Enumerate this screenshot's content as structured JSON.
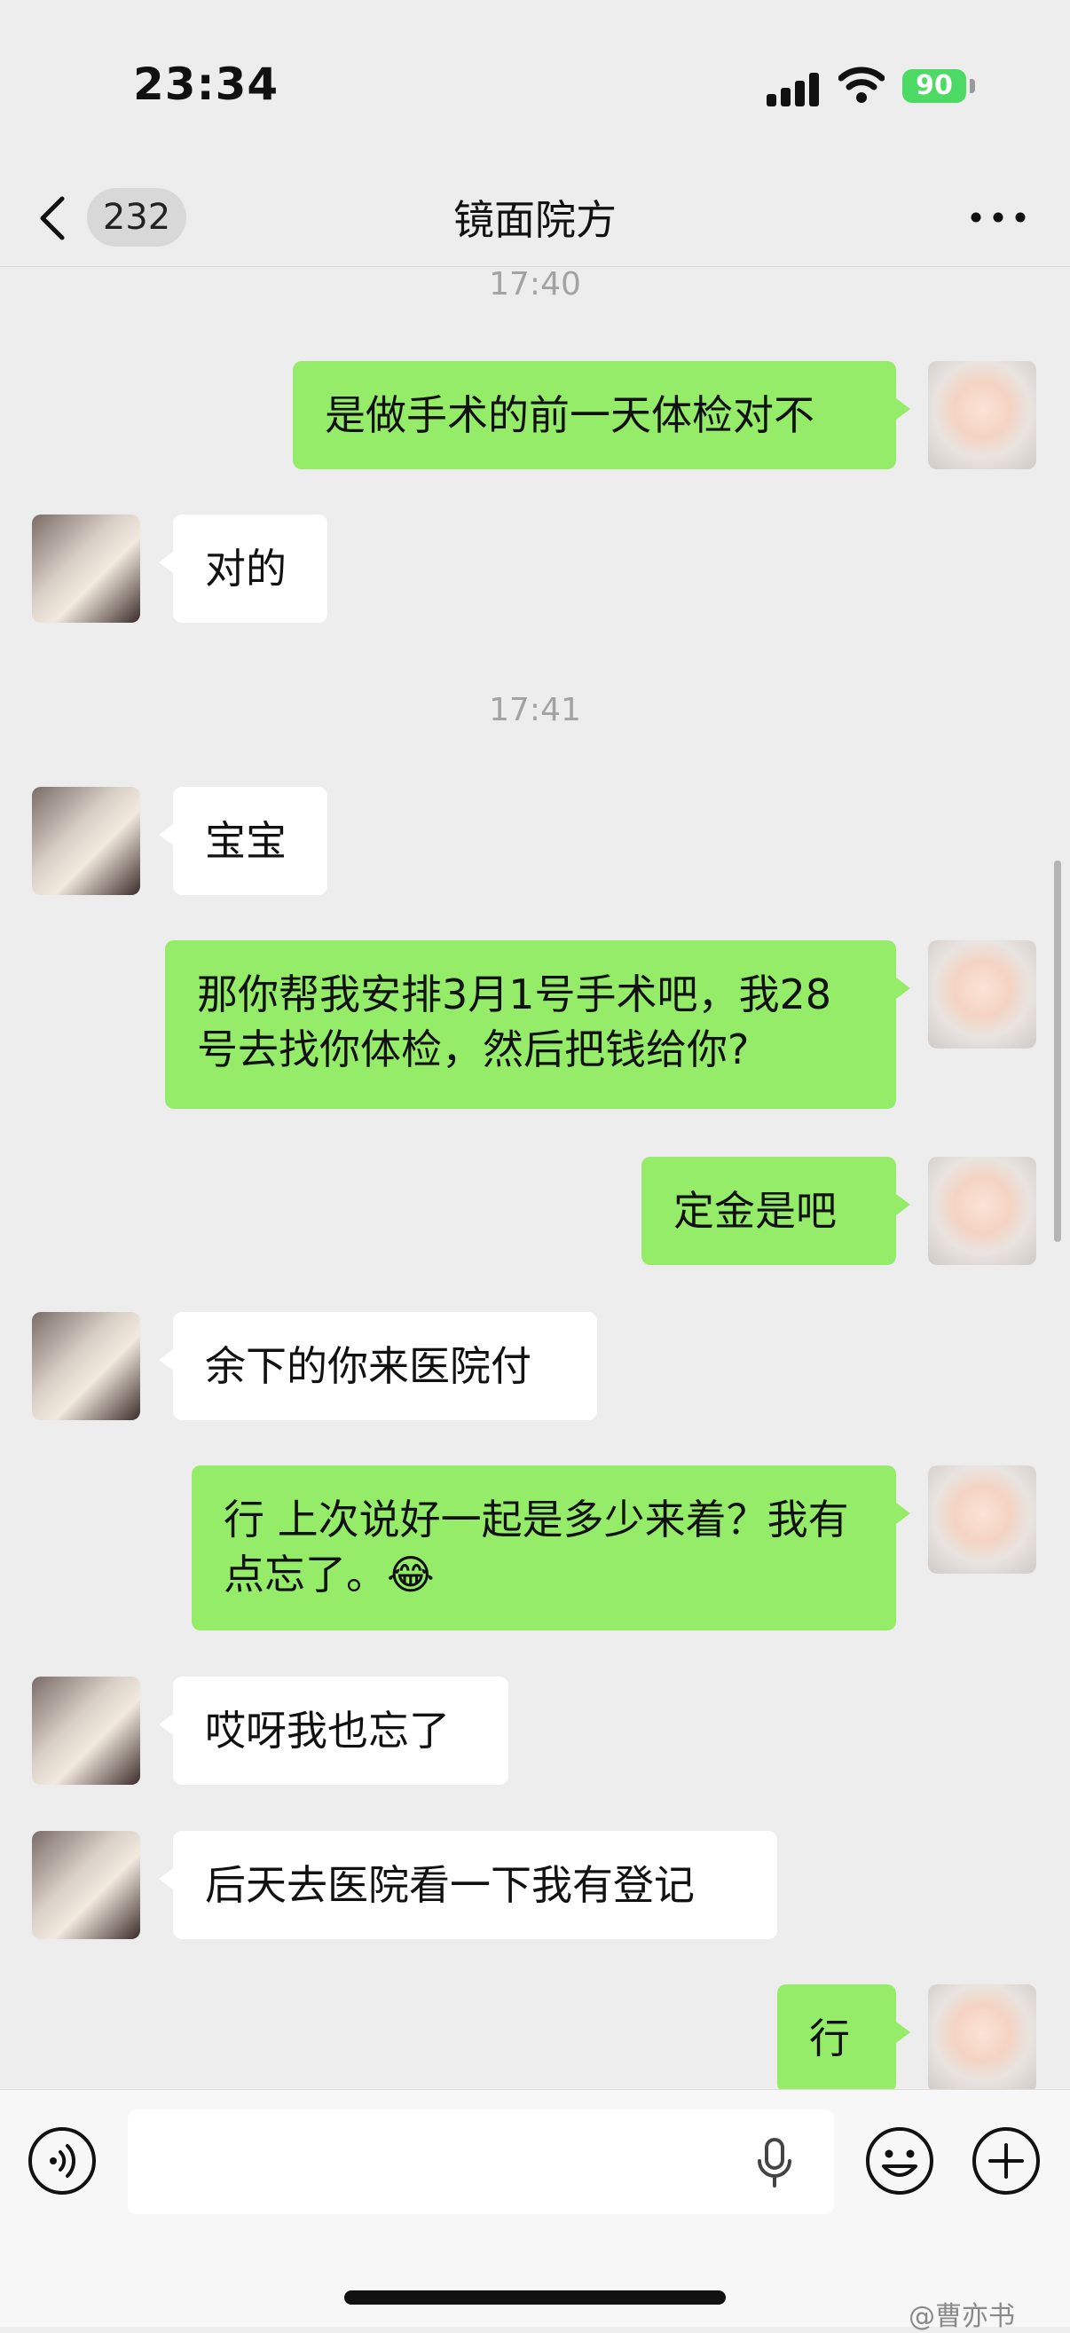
{
  "status_bar": {
    "time": "23:34",
    "battery": "90"
  },
  "nav": {
    "back_count": "232",
    "title": "镜面院方"
  },
  "messages": [
    {
      "type": "timestamp",
      "text": "17:40"
    },
    {
      "type": "out",
      "text": "是做手术的前一天体检对不"
    },
    {
      "type": "in",
      "text": "对的"
    },
    {
      "type": "timestamp",
      "text": "17:41"
    },
    {
      "type": "in",
      "text": "宝宝"
    },
    {
      "type": "out",
      "text": "那你帮我安排3月1号手术吧，我28号去找你体检，然后把钱给你?"
    },
    {
      "type": "out",
      "text": "定金是吧"
    },
    {
      "type": "in",
      "text": "余下的你来医院付"
    },
    {
      "type": "out",
      "text": "行 上次说好一起是多少来着？我有点忘了。😂"
    },
    {
      "type": "in",
      "text": "哎呀我也忘了"
    },
    {
      "type": "in",
      "text": "后天去医院看一下我有登记"
    },
    {
      "type": "out",
      "text": "行"
    }
  ],
  "input": {
    "placeholder": ""
  },
  "watermark": "@曹亦书",
  "colors": {
    "background": "#ededed",
    "outgoing_bubble": "#95ec69",
    "incoming_bubble": "#ffffff",
    "battery": "#4cd964"
  },
  "icons": [
    "back-chevron-icon",
    "more-dots-icon",
    "voice-icon",
    "microphone-icon",
    "emoji-icon",
    "add-icon",
    "signal-icon",
    "wifi-icon",
    "battery-icon"
  ]
}
